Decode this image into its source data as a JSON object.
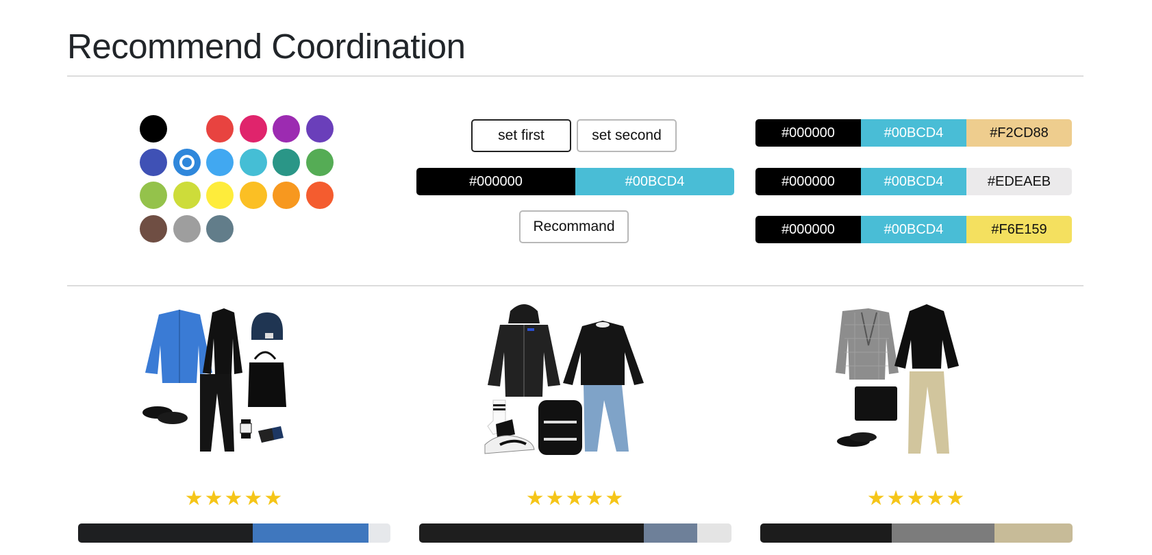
{
  "page": {
    "title": "Recommend Coordination"
  },
  "palette": [
    {
      "name": "black",
      "color": "#000000"
    },
    {
      "name": "white",
      "color": "#FFFFFF"
    },
    {
      "name": "red",
      "color": "#E84340"
    },
    {
      "name": "pink",
      "color": "#E0246C"
    },
    {
      "name": "purple",
      "color": "#9C2BB1"
    },
    {
      "name": "deep-purple",
      "color": "#6A3FBA"
    },
    {
      "name": "indigo",
      "color": "#3F51B5"
    },
    {
      "name": "blue",
      "color": "#2F87DB",
      "selected": true
    },
    {
      "name": "light-blue",
      "color": "#41A8F1"
    },
    {
      "name": "cyan",
      "color": "#45BED5"
    },
    {
      "name": "teal",
      "color": "#2A9687"
    },
    {
      "name": "green",
      "color": "#55AC55"
    },
    {
      "name": "light-green",
      "color": "#94C24B"
    },
    {
      "name": "lime",
      "color": "#CDDC3A"
    },
    {
      "name": "yellow",
      "color": "#FEEC3B"
    },
    {
      "name": "amber",
      "color": "#FBBF24"
    },
    {
      "name": "orange",
      "color": "#F7981F"
    },
    {
      "name": "deep-orange",
      "color": "#F45C2F"
    },
    {
      "name": "brown",
      "color": "#6F4E43"
    },
    {
      "name": "grey",
      "color": "#9E9E9E"
    },
    {
      "name": "blue-grey",
      "color": "#627D8A"
    }
  ],
  "controls": {
    "set_first": "set first",
    "set_second": "set second",
    "recommend": "Recommand",
    "selected": [
      {
        "label": "#000000",
        "bg": "#000000",
        "fg": "#ffffff"
      },
      {
        "label": "#00BCD4",
        "bg": "#49BDD6",
        "fg": "#ffffff"
      }
    ]
  },
  "results": [
    [
      {
        "label": "#000000",
        "bg": "#000000",
        "fg": "#ffffff"
      },
      {
        "label": "#00BCD4",
        "bg": "#49BDD6",
        "fg": "#ffffff"
      },
      {
        "label": "#F2CD88",
        "bg": "#EECD8E",
        "fg": "#111111"
      }
    ],
    [
      {
        "label": "#000000",
        "bg": "#000000",
        "fg": "#ffffff"
      },
      {
        "label": "#00BCD4",
        "bg": "#49BDD6",
        "fg": "#ffffff"
      },
      {
        "label": "#EDEAEB",
        "bg": "#EBEAEB",
        "fg": "#111111"
      }
    ],
    [
      {
        "label": "#000000",
        "bg": "#000000",
        "fg": "#ffffff"
      },
      {
        "label": "#00BCD4",
        "bg": "#49BDD6",
        "fg": "#ffffff"
      },
      {
        "label": "#F6E159",
        "bg": "#F4E05F",
        "fg": "#111111"
      }
    ]
  ],
  "outfits": [
    {
      "name": "blue-cardigan-outfit",
      "rating": 5,
      "colors": [
        {
          "color": "#1E1F21",
          "weight": 56
        },
        {
          "color": "#3F77BE",
          "weight": 37
        },
        {
          "color": "#E6E8EB",
          "weight": 7
        }
      ]
    },
    {
      "name": "black-bomber-outfit",
      "rating": 5,
      "colors": [
        {
          "color": "#1E1E1E",
          "weight": 72
        },
        {
          "color": "#6E8099",
          "weight": 17
        },
        {
          "color": "#E4E4E4",
          "weight": 11
        }
      ]
    },
    {
      "name": "check-blazer-outfit",
      "rating": 5,
      "colors": [
        {
          "color": "#1C1C1C",
          "weight": 42
        },
        {
          "color": "#7C7C7C",
          "weight": 33
        },
        {
          "color": "#C7BB98",
          "weight": 25
        }
      ]
    }
  ]
}
